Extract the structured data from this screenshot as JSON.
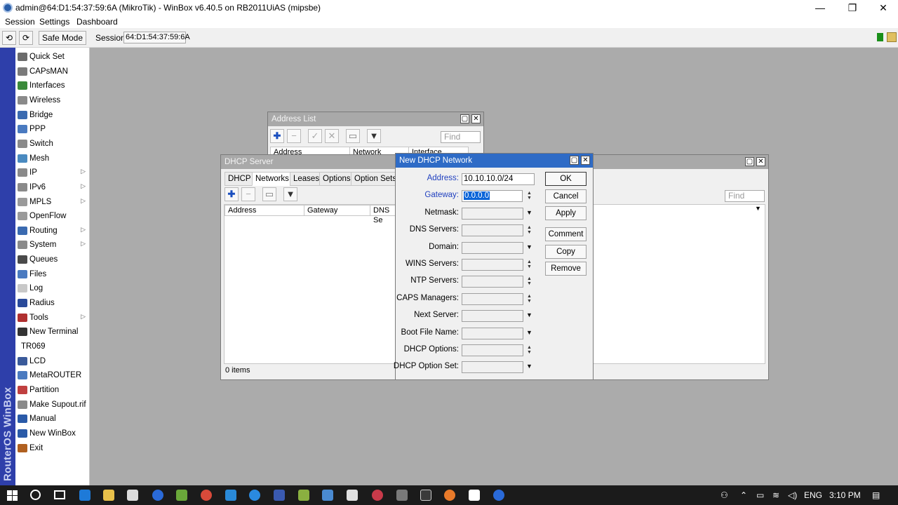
{
  "app": {
    "title": "admin@64:D1:54:37:59:6A (MikroTik) - WinBox v6.40.5 on RB2011UiAS (mipsbe)",
    "minimize": "—",
    "maximize": "❐",
    "close": "✕"
  },
  "menu": {
    "session": "Session",
    "settings": "Settings",
    "dashboard": "Dashboard"
  },
  "toolbar": {
    "undo": "⟲",
    "redo": "⟳",
    "safe_mode": "Safe Mode",
    "session_label": "Session:",
    "session_value": "64:D1:54:37:59:6A"
  },
  "brand": "RouterOS WinBox",
  "sidebar": [
    {
      "label": "Quick Set",
      "icon": "quick-set-icon",
      "color": "#6b6b6b",
      "arrow": ""
    },
    {
      "label": "CAPsMAN",
      "icon": "capsman-icon",
      "color": "#7a7a7a",
      "arrow": ""
    },
    {
      "label": "Interfaces",
      "icon": "interfaces-icon",
      "color": "#3a8a3a",
      "arrow": ""
    },
    {
      "label": "Wireless",
      "icon": "wireless-icon",
      "color": "#8a8a8a",
      "arrow": ""
    },
    {
      "label": "Bridge",
      "icon": "bridge-icon",
      "color": "#3a6ab0",
      "arrow": ""
    },
    {
      "label": "PPP",
      "icon": "ppp-icon",
      "color": "#4a7ac0",
      "arrow": ""
    },
    {
      "label": "Switch",
      "icon": "switch-icon",
      "color": "#8a8a8a",
      "arrow": ""
    },
    {
      "label": "Mesh",
      "icon": "mesh-icon",
      "color": "#4a8ac0",
      "arrow": ""
    },
    {
      "label": "IP",
      "icon": "ip-icon",
      "color": "#8a8a8a",
      "arrow": "▷"
    },
    {
      "label": "IPv6",
      "icon": "ipv6-icon",
      "color": "#8a8a8a",
      "arrow": "▷"
    },
    {
      "label": "MPLS",
      "icon": "mpls-icon",
      "color": "#9a9a9a",
      "arrow": "▷"
    },
    {
      "label": "OpenFlow",
      "icon": "openflow-icon",
      "color": "#9a9a9a",
      "arrow": ""
    },
    {
      "label": "Routing",
      "icon": "routing-icon",
      "color": "#3a6ab0",
      "arrow": "▷"
    },
    {
      "label": "System",
      "icon": "system-icon",
      "color": "#8a8a8a",
      "arrow": "▷"
    },
    {
      "label": "Queues",
      "icon": "queues-icon",
      "color": "#4a4a4a",
      "arrow": ""
    },
    {
      "label": "Files",
      "icon": "files-icon",
      "color": "#4a7ac0",
      "arrow": ""
    },
    {
      "label": "Log",
      "icon": "log-icon",
      "color": "#c8c8c8",
      "arrow": ""
    },
    {
      "label": "Radius",
      "icon": "radius-icon",
      "color": "#2a4a9a",
      "arrow": ""
    },
    {
      "label": "Tools",
      "icon": "tools-icon",
      "color": "#b03030",
      "arrow": "▷"
    },
    {
      "label": "New Terminal",
      "icon": "terminal-icon",
      "color": "#333333",
      "arrow": ""
    },
    {
      "label": "TR069",
      "icon": "",
      "color": "",
      "arrow": ""
    },
    {
      "label": "LCD",
      "icon": "lcd-icon",
      "color": "#3a5a9a",
      "arrow": ""
    },
    {
      "label": "MetaROUTER",
      "icon": "metarouter-icon",
      "color": "#4a7ac0",
      "arrow": ""
    },
    {
      "label": "Partition",
      "icon": "partition-icon",
      "color": "#c04040",
      "arrow": ""
    },
    {
      "label": "Make Supout.rif",
      "icon": "supout-icon",
      "color": "#8a8a8a",
      "arrow": ""
    },
    {
      "label": "Manual",
      "icon": "manual-icon",
      "color": "#2a5aa8",
      "arrow": ""
    },
    {
      "label": "New WinBox",
      "icon": "winbox-icon",
      "color": "#2a5aa8",
      "arrow": ""
    },
    {
      "label": "Exit",
      "icon": "exit-icon",
      "color": "#b06020",
      "arrow": ""
    }
  ],
  "address_list": {
    "title": "Address List",
    "find": "Find",
    "columns": [
      "Address",
      "Network",
      "Interface"
    ]
  },
  "dhcp_server": {
    "title": "DHCP Server",
    "tabs": [
      "DHCP",
      "Networks",
      "Leases",
      "Options",
      "Option Sets"
    ],
    "active_tab": "Networks",
    "find": "Find",
    "columns": [
      "Address",
      "Gateway",
      "DNS Se"
    ],
    "status": "0 items"
  },
  "new_dhcp_network": {
    "title": "New DHCP Network",
    "fields": [
      {
        "label": "Address:",
        "value": "10.10.10.0/24",
        "control": "none",
        "style": "blue"
      },
      {
        "label": "Gateway:",
        "value": "0.0.0.0",
        "control": "spin",
        "style": "blue"
      },
      {
        "label": "Netmask:",
        "value": "",
        "control": "dropdown",
        "style": ""
      },
      {
        "label": "DNS Servers:",
        "value": "",
        "control": "spin",
        "style": ""
      },
      {
        "label": "Domain:",
        "value": "",
        "control": "dropdown",
        "style": ""
      },
      {
        "label": "WINS Servers:",
        "value": "",
        "control": "spin",
        "style": ""
      },
      {
        "label": "NTP Servers:",
        "value": "",
        "control": "spin",
        "style": ""
      },
      {
        "label": "CAPS Managers:",
        "value": "",
        "control": "spin",
        "style": ""
      },
      {
        "label": "Next Server:",
        "value": "",
        "control": "dropdown",
        "style": ""
      },
      {
        "label": "Boot File Name:",
        "value": "",
        "control": "dropdown",
        "style": ""
      },
      {
        "label": "DHCP Options:",
        "value": "",
        "control": "spin",
        "style": ""
      },
      {
        "label": "DHCP Option Set:",
        "value": "",
        "control": "dropdown",
        "style": ""
      }
    ],
    "buttons": {
      "ok": "OK",
      "cancel": "Cancel",
      "apply": "Apply",
      "comment": "Comment",
      "copy": "Copy",
      "remove": "Remove"
    }
  },
  "taskbar": {
    "lang": "ENG",
    "time": "3:10 PM"
  }
}
